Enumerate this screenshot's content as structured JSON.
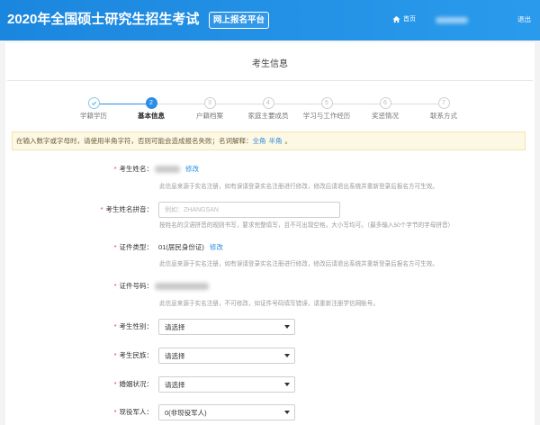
{
  "header": {
    "title": "2020年全国硕士研究生招生考试",
    "badge": "网上报名平台",
    "home_label": "首页",
    "logout_label": "退出",
    "home_icon": "home-icon"
  },
  "page": {
    "title": "考生信息"
  },
  "steps": [
    {
      "label": "学籍学历",
      "state": "done",
      "icon": "check-icon"
    },
    {
      "num": "2",
      "label": "基本信息",
      "state": "active"
    },
    {
      "num": "3",
      "label": "户籍档案",
      "state": "pending"
    },
    {
      "num": "4",
      "label": "家庭主要成员",
      "state": "pending"
    },
    {
      "num": "5",
      "label": "学习与工作经历",
      "state": "pending"
    },
    {
      "num": "6",
      "label": "奖惩情况",
      "state": "pending"
    },
    {
      "num": "7",
      "label": "联系方式",
      "state": "pending"
    }
  ],
  "notice": {
    "text": "在输入数字或字母时，请使用半角字符，否则可能会造成报名失败；名词解释：",
    "link_full": "全角",
    "link_half": "半角",
    "end": "。"
  },
  "form": {
    "required_mark": "*",
    "name": {
      "label": "考生姓名：",
      "edit": "修改",
      "help": "此信息来源于实名注册，如有误请登录实名注册进行修改，修改后请退出系统并重新登录后报名方可生效。"
    },
    "pinyin": {
      "label": "考生姓名拼音：",
      "placeholder": "例如：ZHANGSAN",
      "help": "按姓名的汉语拼音的规则书写，要求完整填写，且不可出现空格，大小写均可。（最多输入50个字节的字母拼音）"
    },
    "id_type": {
      "label": "证件类型：",
      "value": "01(居民身份证)",
      "edit": "修改",
      "help": "此信息来源于实名注册，如有误请登录实名注册进行修改，修改后请退出系统并重新登录后报名方可生效。"
    },
    "id_number": {
      "label": "证件号码：",
      "help": "此信息来源于实名注册，不可修改，如证件号码填写错误，请重新注册学信网账号。"
    },
    "gender": {
      "label": "考生性别：",
      "value": "请选择"
    },
    "ethnicity": {
      "label": "考生民族：",
      "value": "请选择"
    },
    "marital": {
      "label": "婚姻状况：",
      "value": "请选择"
    },
    "military": {
      "label": "现役军人：",
      "value": "0(非现役军人)"
    }
  },
  "colors": {
    "header_start": "#1b86de",
    "header_end": "#2a9bec",
    "accent": "#2b8ee6",
    "required": "#e23c3c",
    "notice_bg": "#fcf8e3",
    "notice_border": "#f4e4b0"
  }
}
